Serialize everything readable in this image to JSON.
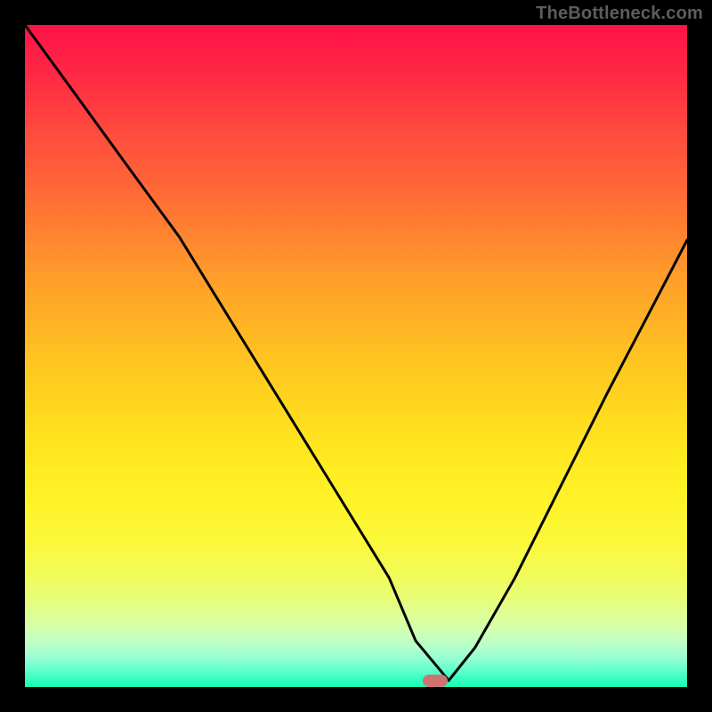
{
  "watermark": "TheBottleneck.com",
  "marker": {
    "cx_frac": 0.619,
    "cy_frac": 0.991
  },
  "chart_data": {
    "type": "line",
    "title": "",
    "xlabel": "",
    "ylabel": "",
    "xlim": [
      0,
      1
    ],
    "ylim": [
      0,
      1
    ],
    "note": "Axes are unlabeled; values are normalized fractions of the plot area. y is inverted (0 = top).",
    "series": [
      {
        "name": "bottleneck-curve",
        "x": [
          0.0,
          0.08,
          0.16,
          0.233,
          0.31,
          0.39,
          0.47,
          0.55,
          0.59,
          0.64,
          0.68,
          0.74,
          0.81,
          0.88,
          0.94,
          1.0
        ],
        "y": [
          0.0,
          0.11,
          0.22,
          0.32,
          0.445,
          0.575,
          0.705,
          0.835,
          0.93,
          0.99,
          0.94,
          0.835,
          0.695,
          0.555,
          0.44,
          0.325
        ]
      }
    ],
    "background_gradient_stops": [
      {
        "offset": 0.0,
        "color": "#ff1248"
      },
      {
        "offset": 0.25,
        "color": "#ff6936"
      },
      {
        "offset": 0.5,
        "color": "#ffc221"
      },
      {
        "offset": 0.72,
        "color": "#fff328"
      },
      {
        "offset": 0.88,
        "color": "#daffa0"
      },
      {
        "offset": 1.0,
        "color": "#16ffb0"
      }
    ]
  }
}
